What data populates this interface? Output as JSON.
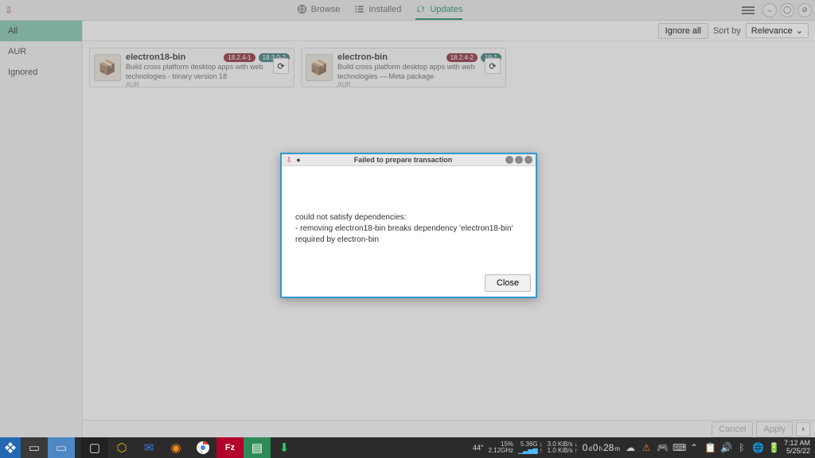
{
  "header": {
    "tabs": {
      "browse": "Browse",
      "installed": "Installed",
      "updates": "Updates"
    }
  },
  "sidebar": {
    "all": "All",
    "aur": "AUR",
    "ignored": "Ignored"
  },
  "toolbar": {
    "ignore_all": "Ignore all",
    "sort_by_label": "Sort by",
    "sort_value": "Relevance"
  },
  "cards": [
    {
      "title": "electron18-bin",
      "old_version": "18.2.4-1",
      "new_version": "18.3.0-2",
      "desc": "Build cross platform desktop apps with web technologies - binary version 18",
      "repo": "AUR"
    },
    {
      "title": "electron-bin",
      "old_version": "18.2.4-2",
      "new_version": "19-1",
      "desc": "Build cross platform desktop apps with web technologies — Meta package",
      "repo": "AUR"
    }
  ],
  "bottom": {
    "cancel": "Cancel",
    "apply": "Apply"
  },
  "dialog": {
    "title": "Failed to prepare transaction",
    "line1": "could not satisfy dependencies:",
    "line2": "- removing electron18-bin breaks dependency 'electron18-bin' required by electron-bin",
    "close": "Close"
  },
  "taskbar": {
    "temp": "44°",
    "cpu_pct": "15%",
    "cpu_freq": "2.12GHz",
    "mem": "5.36G",
    "net_down": "3.0 KiB/s",
    "net_up": "1.0 KiB/s",
    "uptime_d": "0",
    "uptime_d_label": "d",
    "uptime_h": "0",
    "uptime_h_label": "h",
    "uptime_m": "28",
    "uptime_m_label": "m",
    "time": "7:12 AM",
    "date": "5/25/22"
  }
}
